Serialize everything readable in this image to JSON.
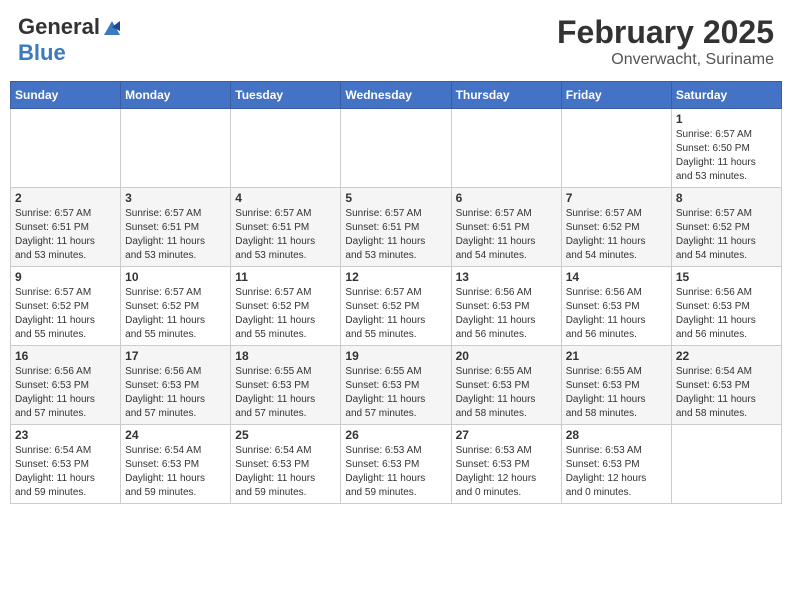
{
  "header": {
    "logo_general": "General",
    "logo_blue": "Blue",
    "month_title": "February 2025",
    "location": "Onverwacht, Suriname"
  },
  "weekdays": [
    "Sunday",
    "Monday",
    "Tuesday",
    "Wednesday",
    "Thursday",
    "Friday",
    "Saturday"
  ],
  "weeks": [
    [
      {
        "day": "",
        "info": ""
      },
      {
        "day": "",
        "info": ""
      },
      {
        "day": "",
        "info": ""
      },
      {
        "day": "",
        "info": ""
      },
      {
        "day": "",
        "info": ""
      },
      {
        "day": "",
        "info": ""
      },
      {
        "day": "1",
        "info": "Sunrise: 6:57 AM\nSunset: 6:50 PM\nDaylight: 11 hours\nand 53 minutes."
      }
    ],
    [
      {
        "day": "2",
        "info": "Sunrise: 6:57 AM\nSunset: 6:51 PM\nDaylight: 11 hours\nand 53 minutes."
      },
      {
        "day": "3",
        "info": "Sunrise: 6:57 AM\nSunset: 6:51 PM\nDaylight: 11 hours\nand 53 minutes."
      },
      {
        "day": "4",
        "info": "Sunrise: 6:57 AM\nSunset: 6:51 PM\nDaylight: 11 hours\nand 53 minutes."
      },
      {
        "day": "5",
        "info": "Sunrise: 6:57 AM\nSunset: 6:51 PM\nDaylight: 11 hours\nand 53 minutes."
      },
      {
        "day": "6",
        "info": "Sunrise: 6:57 AM\nSunset: 6:51 PM\nDaylight: 11 hours\nand 54 minutes."
      },
      {
        "day": "7",
        "info": "Sunrise: 6:57 AM\nSunset: 6:52 PM\nDaylight: 11 hours\nand 54 minutes."
      },
      {
        "day": "8",
        "info": "Sunrise: 6:57 AM\nSunset: 6:52 PM\nDaylight: 11 hours\nand 54 minutes."
      }
    ],
    [
      {
        "day": "9",
        "info": "Sunrise: 6:57 AM\nSunset: 6:52 PM\nDaylight: 11 hours\nand 55 minutes."
      },
      {
        "day": "10",
        "info": "Sunrise: 6:57 AM\nSunset: 6:52 PM\nDaylight: 11 hours\nand 55 minutes."
      },
      {
        "day": "11",
        "info": "Sunrise: 6:57 AM\nSunset: 6:52 PM\nDaylight: 11 hours\nand 55 minutes."
      },
      {
        "day": "12",
        "info": "Sunrise: 6:57 AM\nSunset: 6:52 PM\nDaylight: 11 hours\nand 55 minutes."
      },
      {
        "day": "13",
        "info": "Sunrise: 6:56 AM\nSunset: 6:53 PM\nDaylight: 11 hours\nand 56 minutes."
      },
      {
        "day": "14",
        "info": "Sunrise: 6:56 AM\nSunset: 6:53 PM\nDaylight: 11 hours\nand 56 minutes."
      },
      {
        "day": "15",
        "info": "Sunrise: 6:56 AM\nSunset: 6:53 PM\nDaylight: 11 hours\nand 56 minutes."
      }
    ],
    [
      {
        "day": "16",
        "info": "Sunrise: 6:56 AM\nSunset: 6:53 PM\nDaylight: 11 hours\nand 57 minutes."
      },
      {
        "day": "17",
        "info": "Sunrise: 6:56 AM\nSunset: 6:53 PM\nDaylight: 11 hours\nand 57 minutes."
      },
      {
        "day": "18",
        "info": "Sunrise: 6:55 AM\nSunset: 6:53 PM\nDaylight: 11 hours\nand 57 minutes."
      },
      {
        "day": "19",
        "info": "Sunrise: 6:55 AM\nSunset: 6:53 PM\nDaylight: 11 hours\nand 57 minutes."
      },
      {
        "day": "20",
        "info": "Sunrise: 6:55 AM\nSunset: 6:53 PM\nDaylight: 11 hours\nand 58 minutes."
      },
      {
        "day": "21",
        "info": "Sunrise: 6:55 AM\nSunset: 6:53 PM\nDaylight: 11 hours\nand 58 minutes."
      },
      {
        "day": "22",
        "info": "Sunrise: 6:54 AM\nSunset: 6:53 PM\nDaylight: 11 hours\nand 58 minutes."
      }
    ],
    [
      {
        "day": "23",
        "info": "Sunrise: 6:54 AM\nSunset: 6:53 PM\nDaylight: 11 hours\nand 59 minutes."
      },
      {
        "day": "24",
        "info": "Sunrise: 6:54 AM\nSunset: 6:53 PM\nDaylight: 11 hours\nand 59 minutes."
      },
      {
        "day": "25",
        "info": "Sunrise: 6:54 AM\nSunset: 6:53 PM\nDaylight: 11 hours\nand 59 minutes."
      },
      {
        "day": "26",
        "info": "Sunrise: 6:53 AM\nSunset: 6:53 PM\nDaylight: 11 hours\nand 59 minutes."
      },
      {
        "day": "27",
        "info": "Sunrise: 6:53 AM\nSunset: 6:53 PM\nDaylight: 12 hours\nand 0 minutes."
      },
      {
        "day": "28",
        "info": "Sunrise: 6:53 AM\nSunset: 6:53 PM\nDaylight: 12 hours\nand 0 minutes."
      },
      {
        "day": "",
        "info": ""
      }
    ]
  ]
}
